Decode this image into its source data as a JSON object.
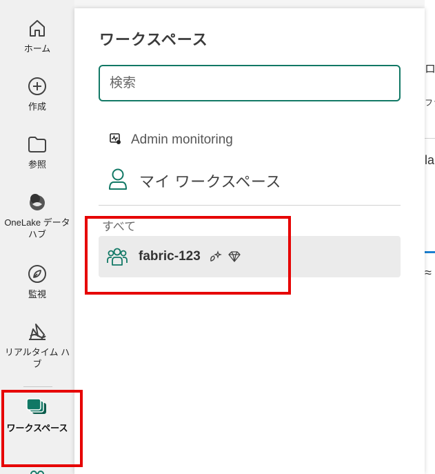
{
  "nav": {
    "items": [
      {
        "label": "ホーム",
        "icon": "home-icon"
      },
      {
        "label": "作成",
        "icon": "plus-circle-icon"
      },
      {
        "label": "参照",
        "icon": "folder-icon"
      },
      {
        "label": "OneLake データ ハブ",
        "icon": "onelake-icon"
      },
      {
        "label": "監視",
        "icon": "monitor-icon"
      },
      {
        "label": "リアルタイム ハブ",
        "icon": "realtime-hub-icon"
      },
      {
        "label": "ワークスペース",
        "icon": "workspaces-icon",
        "active": true
      }
    ],
    "accent_color": "#117865"
  },
  "flyout": {
    "title": "ワークスペース",
    "search": {
      "placeholder": "検索",
      "value": ""
    },
    "admin_monitoring": {
      "label": "Admin monitoring",
      "icon": "admin-monitoring-icon"
    },
    "my_workspace": {
      "label": "マイ ワークスペース",
      "icon": "person-icon"
    },
    "section_all": "すべて",
    "workspaces": [
      {
        "name": "fabric-123",
        "icon": "group-workspace-icon",
        "badges": [
          "sparkle-capacity-icon",
          "premium-diamond-icon"
        ]
      }
    ]
  },
  "background_fragments": [
    "ロ",
    "ファ",
    "la",
    "≈"
  ],
  "highlight_color": "#e60000"
}
